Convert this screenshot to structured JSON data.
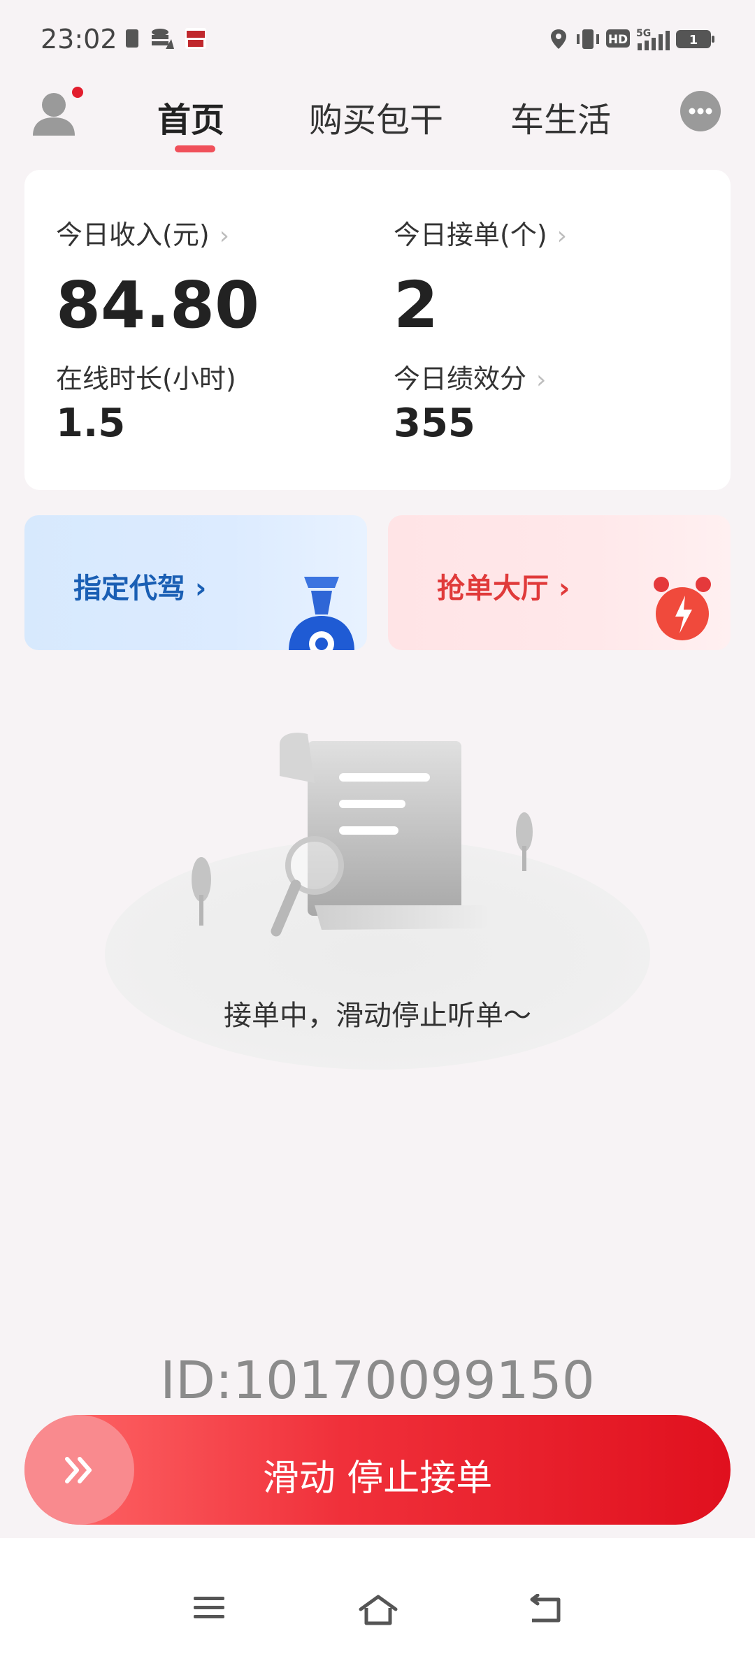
{
  "status_bar": {
    "time": "23:02",
    "network_label": "5G",
    "battery_label": "1",
    "icons": [
      "sim-icon",
      "data-icon",
      "app-notification-icon",
      "location-icon",
      "vibrate-icon",
      "hd-icon",
      "signal-icon",
      "battery-icon"
    ]
  },
  "top_nav": {
    "tabs": [
      {
        "label": "首页",
        "active": true
      },
      {
        "label": "购买包干",
        "active": false
      },
      {
        "label": "车生活",
        "active": false
      }
    ],
    "accent_color": "#f0505a"
  },
  "stats": {
    "income": {
      "label": "今日收入(元)",
      "value": "84.80"
    },
    "orders": {
      "label": "今日接单(个)",
      "value": "2"
    },
    "online": {
      "label": "在线时长(小时)",
      "value": "1.5"
    },
    "performance": {
      "label": "今日绩效分",
      "value": "355"
    }
  },
  "promos": {
    "designated": {
      "label": "指定代驾 ›",
      "color": "#1a5fb4"
    },
    "grab": {
      "label": "抢单大厅 ›",
      "color": "#e03a3a"
    }
  },
  "empty_state": {
    "text": "接单中，滑动停止听单～"
  },
  "driver_id": "ID:10170099150",
  "slider": {
    "label": "滑动 停止接单",
    "knob_icon": "double-chevron-right-icon"
  },
  "system_nav": [
    "menu-icon",
    "home-icon",
    "back-icon"
  ]
}
